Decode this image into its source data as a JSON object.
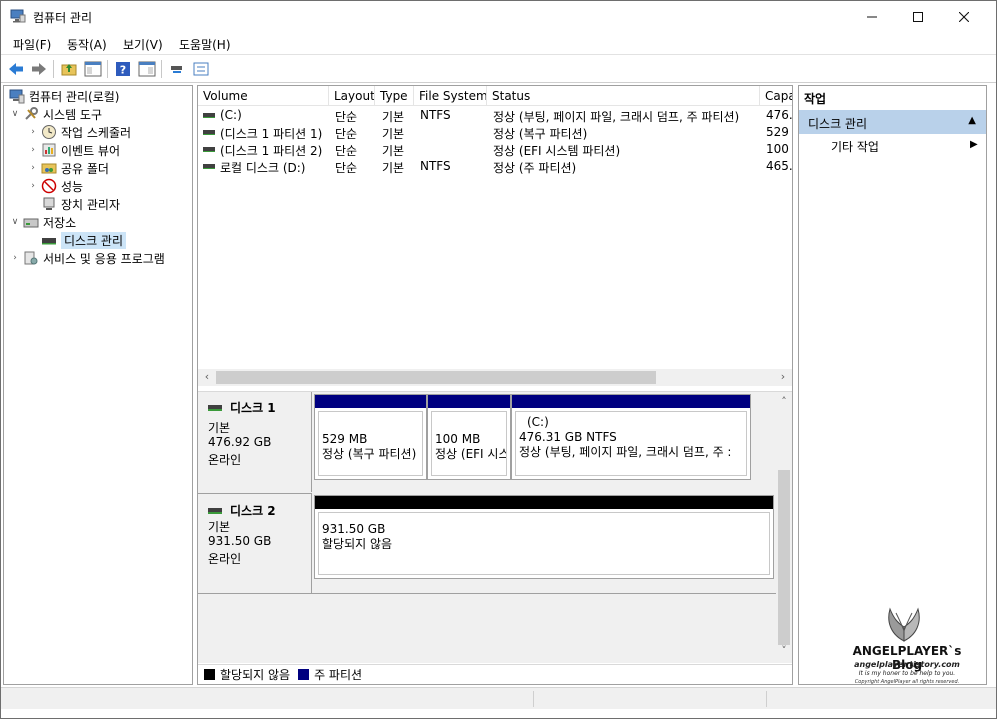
{
  "window": {
    "title": "컴퓨터 관리"
  },
  "menu": {
    "items": [
      "파일(F)",
      "동작(A)",
      "보기(V)",
      "도움말(H)"
    ]
  },
  "toolbar": {
    "icons": [
      "back-icon",
      "forward-icon",
      "up-folder-icon",
      "show-hide-tree-icon",
      "help-icon",
      "show-hide-action-icon",
      "connect-icon",
      "properties-icon"
    ]
  },
  "tree": {
    "root": "컴퓨터 관리(로컬)",
    "system_tools": "시스템 도구",
    "task_scheduler": "작업 스케줄러",
    "event_viewer": "이벤트 뷰어",
    "shared_folders": "공유 폴더",
    "performance": "성능",
    "device_manager": "장치 관리자",
    "storage": "저장소",
    "disk_management": "디스크 관리",
    "services_apps": "서비스 및 응용 프로그램"
  },
  "volume_list": {
    "columns": [
      "Volume",
      "Layout",
      "Type",
      "File System",
      "Status",
      "Capa"
    ],
    "rows": [
      {
        "volume": "(C:)",
        "layout": "단순",
        "type": "기본",
        "fs": "NTFS",
        "status": "정상 (부팅, 페이지 파일, 크래시 덤프, 주 파티션)",
        "capacity": "476.3"
      },
      {
        "volume": "(디스크 1 파티션 1)",
        "layout": "단순",
        "type": "기본",
        "fs": "",
        "status": "정상 (복구 파티션)",
        "capacity": "529 I"
      },
      {
        "volume": "(디스크 1 파티션 2)",
        "layout": "단순",
        "type": "기본",
        "fs": "",
        "status": "정상 (EFI 시스템 파티션)",
        "capacity": "100 I"
      },
      {
        "volume": "로컬 디스크 (D:)",
        "layout": "단순",
        "type": "기본",
        "fs": "NTFS",
        "status": "정상 (주 파티션)",
        "capacity": "465.7"
      }
    ]
  },
  "disks": [
    {
      "name": "디스크 1",
      "type": "기본",
      "size": "476.92 GB",
      "state": "온라인",
      "partitions": [
        {
          "label": "",
          "size": "529 MB",
          "status": "정상 (복구 파티션)",
          "bar_color": "#000080"
        },
        {
          "label": "",
          "size": "100 MB",
          "status": "정상 (EFI 시스",
          "bar_color": "#000080"
        },
        {
          "label": "(C:)",
          "size": "476.31 GB NTFS",
          "status": "정상 (부팅, 페이지 파일, 크래시 덤프, 주 :",
          "bar_color": "#000080"
        }
      ]
    },
    {
      "name": "디스크 2",
      "type": "기본",
      "size": "931.50 GB",
      "state": "온라인",
      "partitions": [
        {
          "label": "",
          "size": "931.50 GB",
          "status": "할당되지 않음",
          "bar_color": "#000000"
        }
      ]
    }
  ],
  "legend": [
    {
      "label": "할당되지 않음",
      "color": "#000000"
    },
    {
      "label": "주 파티션",
      "color": "#000080"
    }
  ],
  "actions": {
    "header": "작업",
    "section": "디스크 관리",
    "item": "기타 작업"
  },
  "watermark": {
    "title": "ANGELPLAYER`s Blog",
    "url": "angelplayer.tistory.com",
    "line2": "It is my honer to be help to you.",
    "line3": "Copyright AngelPlayer all rights reserved."
  },
  "colors": {
    "primary_partition": "#000080",
    "unallocated": "#000000",
    "selection": "#cce4f7",
    "action_section": "#b9d1ea"
  }
}
